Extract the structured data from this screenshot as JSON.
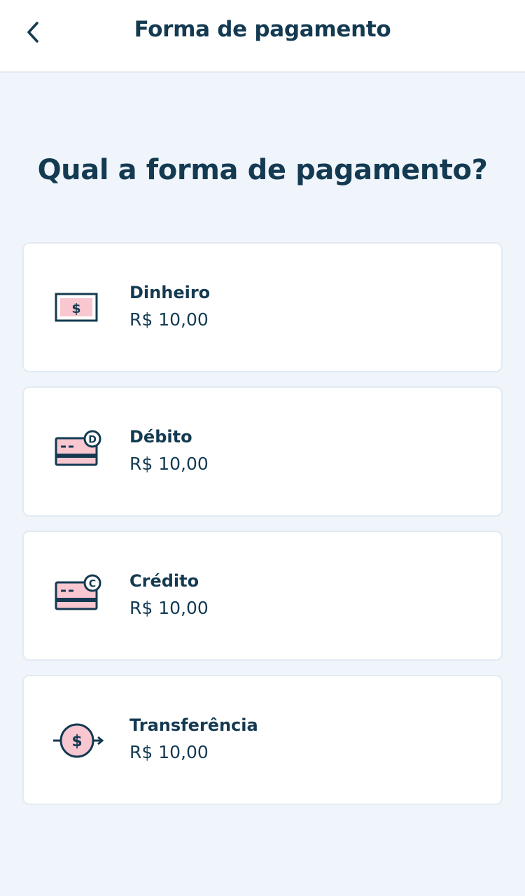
{
  "header": {
    "title": "Forma de pagamento",
    "back_icon": "chevron-left-icon"
  },
  "question": "Qual a forma de pagamento?",
  "colors": {
    "primary": "#143a52",
    "accent_pink": "#f8c7d0",
    "background": "#eff5fb",
    "card": "#ffffff"
  },
  "options": [
    {
      "label": "Dinheiro",
      "value": "R$ 10,00",
      "icon": "cash-bill-icon"
    },
    {
      "label": "Débito",
      "value": "R$ 10,00",
      "icon": "debit-card-icon"
    },
    {
      "label": "Crédito",
      "value": "R$ 10,00",
      "icon": "credit-card-icon"
    },
    {
      "label": "Transferência",
      "value": "R$ 10,00",
      "icon": "transfer-icon"
    }
  ]
}
